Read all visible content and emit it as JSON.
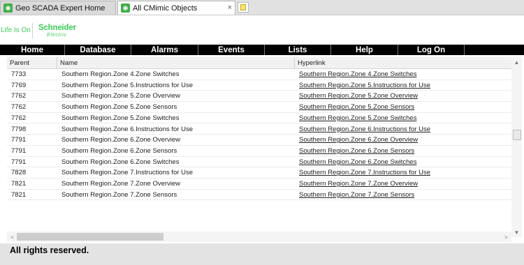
{
  "tabs": [
    {
      "title": "Geo SCADA Expert Home",
      "icon": "wireless-signal-icon",
      "active": false
    },
    {
      "title": "All CMimic Objects",
      "icon": "wireless-signal-icon",
      "active": true,
      "close": "×"
    }
  ],
  "brand": {
    "tagline": "Life Is On",
    "name": "Schneider",
    "sub": "Electric",
    "color": "#3dcd58"
  },
  "nav": [
    "Home",
    "Database",
    "Alarms",
    "Events",
    "Lists",
    "Help",
    "Log On"
  ],
  "table": {
    "columns": [
      "Parent",
      "Name",
      "Hyperlink"
    ],
    "rows": [
      [
        "7733",
        "Southern Region.Zone 4.Zone Switches",
        "Southern Region.Zone 4.Zone Switches"
      ],
      [
        "7769",
        "Southern Region.Zone 5.Instructions for Use",
        "Southern Region.Zone 5.Instructions for Use"
      ],
      [
        "7762",
        "Southern Region.Zone 5.Zone Overview",
        "Southern Region.Zone 5.Zone Overview"
      ],
      [
        "7762",
        "Southern Region.Zone 5.Zone Sensors",
        "Southern Region.Zone 5.Zone Sensors"
      ],
      [
        "7762",
        "Southern Region.Zone 5.Zone Switches",
        "Southern Region.Zone 5.Zone Switches"
      ],
      [
        "7798",
        "Southern Region.Zone 6.Instructions for Use",
        "Southern Region.Zone 6.Instructions for Use"
      ],
      [
        "7791",
        "Southern Region.Zone 6.Zone Overview",
        "Southern Region.Zone 6.Zone Overview"
      ],
      [
        "7791",
        "Southern Region.Zone 6.Zone Sensors",
        "Southern Region.Zone 6.Zone Sensors"
      ],
      [
        "7791",
        "Southern Region.Zone 6.Zone Switches",
        "Southern Region.Zone 6.Zone Switches"
      ],
      [
        "7828",
        "Southern Region.Zone 7.Instructions for Use",
        "Southern Region.Zone 7.Instructions for Use"
      ],
      [
        "7821",
        "Southern Region.Zone 7.Zone Overview",
        "Southern Region.Zone 7.Zone Overview"
      ],
      [
        "7821",
        "Southern Region.Zone 7.Zone Sensors",
        "Southern Region.Zone 7.Zone Sensors"
      ]
    ]
  },
  "scroll": {
    "up": "▲",
    "down": "▼",
    "left": "<",
    "right": ">"
  },
  "footer": {
    "text": "All rights reserved."
  }
}
